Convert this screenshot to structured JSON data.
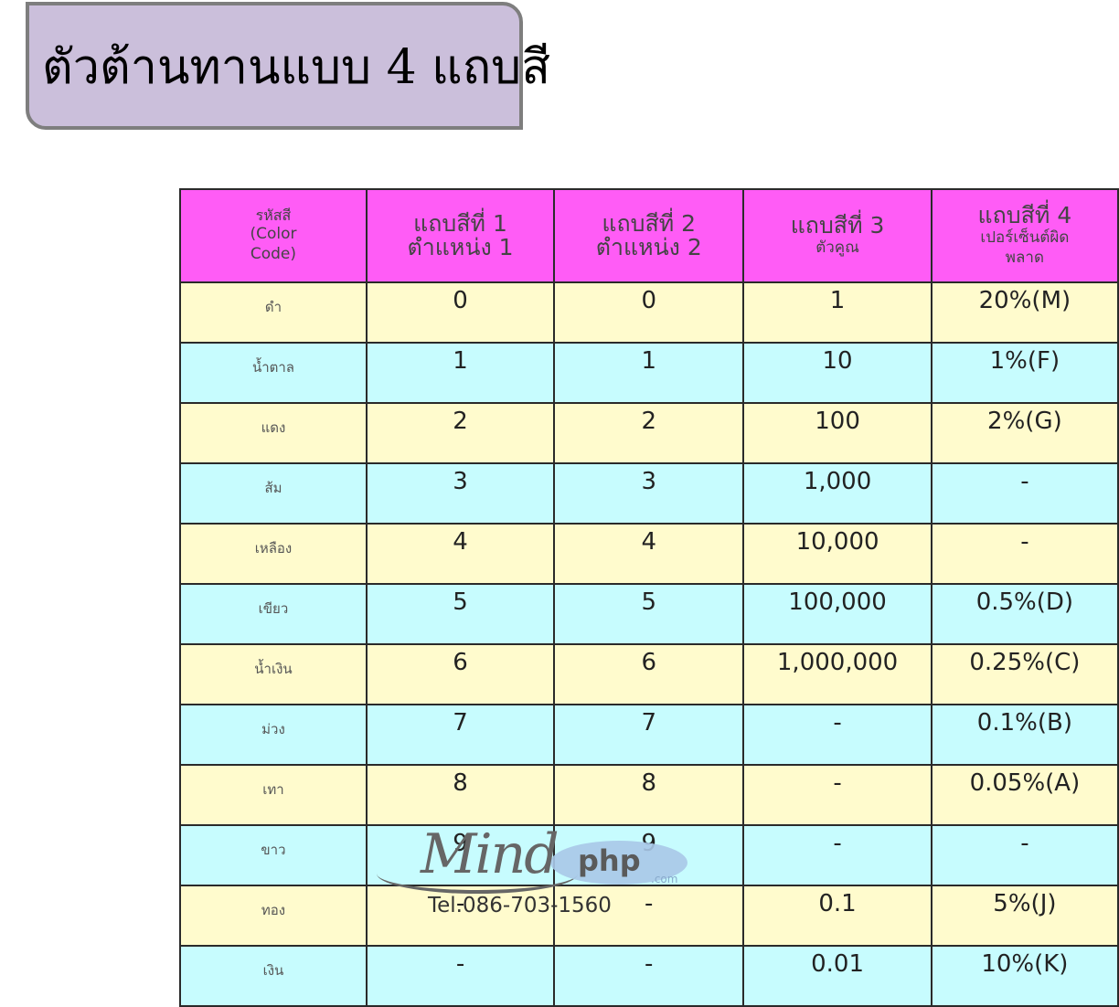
{
  "title": "ตัวต้านทานแบบ 4 แถบสี",
  "table": {
    "headers": [
      {
        "line1": "รหัสสี",
        "line2": "(Color",
        "line3": "Code)"
      },
      {
        "line1": "แถบสีที่ 1",
        "line2": "ตำแหน่ง 1"
      },
      {
        "line1": "แถบสีที่ 2",
        "line2": "ตำแหน่ง 2"
      },
      {
        "line1": "แถบสีที่ 3",
        "line2": "ตัวคูณ"
      },
      {
        "line1": "แถบสีที่ 4",
        "line2": "เปอร์เซ็นต์ผิด",
        "line3": "พลาด"
      }
    ],
    "rows": [
      [
        "ดำ",
        "0",
        "0",
        "1",
        "20%(M)"
      ],
      [
        "น้ำตาล",
        "1",
        "1",
        "10",
        "1%(F)"
      ],
      [
        "แดง",
        "2",
        "2",
        "100",
        "2%(G)"
      ],
      [
        "ส้ม",
        "3",
        "3",
        "1,000",
        "-"
      ],
      [
        "เหลือง",
        "4",
        "4",
        "10,000",
        "-"
      ],
      [
        "เขียว",
        "5",
        "5",
        "100,000",
        "0.5%(D)"
      ],
      [
        "น้ำเงิน",
        "6",
        "6",
        "1,000,000",
        "0.25%(C)"
      ],
      [
        "ม่วง",
        "7",
        "7",
        "-",
        "0.1%(B)"
      ],
      [
        "เทา",
        "8",
        "8",
        "-",
        "0.05%(A)"
      ],
      [
        "ขาว",
        "9",
        "9",
        "-",
        "-"
      ],
      [
        "ทอง",
        "-",
        "-",
        "0.1",
        "5%(J)"
      ],
      [
        "เงิน",
        "-",
        "-",
        "0.01",
        "10%(K)"
      ]
    ]
  },
  "watermark": {
    "logo_main": "Mind",
    "logo_suffix": "php",
    "logo_com": ".com",
    "phone": "Tel.086-703-1560"
  },
  "colors": {
    "header_bg": "#ff5cf6",
    "row_odd_bg": "#fffbcd",
    "row_even_bg": "#c7fcfe",
    "title_bg": "#cbbfdb"
  }
}
